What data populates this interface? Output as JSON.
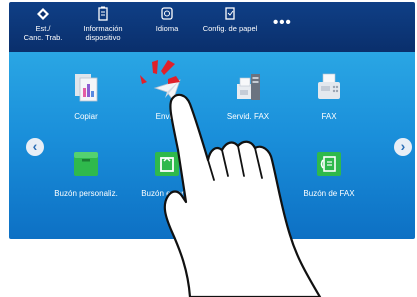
{
  "topbar": {
    "status_label": "Est./\nCanc. Trab.",
    "device_info_label": "Información\ndispositivo",
    "language_label": "Idioma",
    "paper_label": "Config. de papel",
    "more_label": "•••"
  },
  "apps": {
    "copy": "Copiar",
    "send": "Enviar",
    "fax_server": "Servid. FAX",
    "fax": "FAX",
    "custom_box": "Buzón personaliz.",
    "external_box": "Buzón externo",
    "fax_box": "Buzón de FAX"
  },
  "nav": {
    "prev": "‹",
    "next": "›"
  },
  "colors": {
    "topbar": "#0a2f6c",
    "main_gradient_top": "#2aa6e4",
    "main_gradient_bottom": "#0d70c4",
    "box_green": "#2fb94c",
    "tap_red": "#e0202a"
  }
}
